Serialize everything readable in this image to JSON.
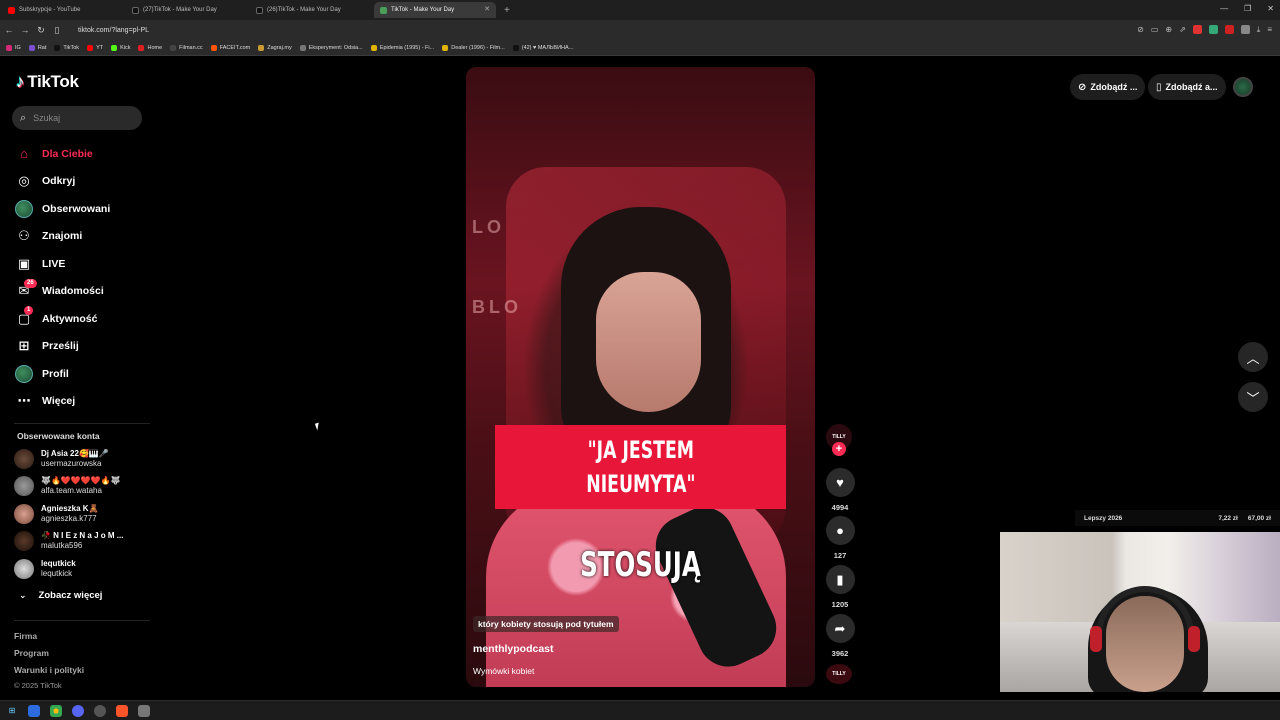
{
  "browser": {
    "tabs": [
      {
        "title": "Subskrypcje - YouTube",
        "favicon_color": "#ff0000",
        "active": false
      },
      {
        "title": "(27)TikTok - Make Your Day",
        "favicon_color": "#111111",
        "active": false
      },
      {
        "title": "(26)TikTok - Make Your Day",
        "favicon_color": "#111111",
        "active": false
      },
      {
        "title": "TikTok - Make Your Day",
        "favicon_color": "#4a9e58",
        "active": true
      }
    ],
    "new_tab": "+",
    "url": "tiktok.com/?lang=pl-PL",
    "bookmarks": [
      {
        "label": "IG",
        "color": "#d62976"
      },
      {
        "label": "Rat",
        "color": "#7a4fd1"
      },
      {
        "label": "TikTok",
        "color": "#111111"
      },
      {
        "label": "YT",
        "color": "#ff0000"
      },
      {
        "label": "Kick",
        "color": "#53fc18"
      },
      {
        "label": "Home",
        "color": "#e02020"
      },
      {
        "label": "Filman.cc",
        "color": "#444444"
      },
      {
        "label": "FACEIT.com",
        "color": "#ff5500"
      },
      {
        "label": "Zagraj.my",
        "color": "#cc9933"
      },
      {
        "label": "Eksperyment: Odsia...",
        "color": "#777777"
      },
      {
        "label": "Epidemia (1995) - Fi...",
        "color": "#e0b400"
      },
      {
        "label": "Dealer (1996) - Film...",
        "color": "#e0b400"
      },
      {
        "label": "(42) ♥ МАЛЬВИНА...",
        "color": "#111111"
      }
    ]
  },
  "tiktok": {
    "logo_text": "TikTok",
    "search_placeholder": "Szukaj",
    "nav": [
      {
        "label": "Dla Ciebie",
        "icon": "home-icon",
        "active": true
      },
      {
        "label": "Odkryj",
        "icon": "compass-icon"
      },
      {
        "label": "Obserwowani",
        "icon": "avatar-icon"
      },
      {
        "label": "Znajomi",
        "icon": "friends-icon"
      },
      {
        "label": "LIVE",
        "icon": "live-icon"
      },
      {
        "label": "Wiadomości",
        "icon": "messages-icon",
        "badge": "26"
      },
      {
        "label": "Aktywność",
        "icon": "activity-icon",
        "badge": "1"
      },
      {
        "label": "Prześlij",
        "icon": "upload-icon"
      },
      {
        "label": "Profil",
        "icon": "profile-icon"
      },
      {
        "label": "Więcej",
        "icon": "more-icon"
      }
    ],
    "followed_title": "Obserwowane konta",
    "followed": [
      {
        "name": "Dj Asia 22🥰🎹🎤",
        "handle": "usermazurowska"
      },
      {
        "name": "🐺🔥❤️❤️❤️❤️🔥🐺",
        "handle": "alfa.team.wataha"
      },
      {
        "name": "Agnieszka K🧸",
        "handle": "agnieszka.k777"
      },
      {
        "name": "🥀 N I E z N a J o M ...",
        "handle": "malutka596"
      },
      {
        "name": "lequtkick",
        "handle": "lequtkick"
      }
    ],
    "see_more": "Zobacz więcej",
    "footer": [
      "Firma",
      "Program",
      "Warunki i polityki"
    ],
    "copyright": "© 2025 TikTok",
    "top_buttons": [
      "Zdobądź ...",
      "Zdobądź a..."
    ]
  },
  "video": {
    "wall_text_1": "LO",
    "wall_text_2": "BLO",
    "caption_line1": "\"JA JESTEM",
    "caption_line2": "NIEUMYTA\"",
    "overlay_word": "STOSUJĄ",
    "subtitle": "który kobiety stosują pod tytułem",
    "author": "menthlypodcast",
    "description": "Wymówki kobiet",
    "creator_badge": "TILLY",
    "counts": {
      "likes": "4994",
      "comments": "127",
      "saves": "1205",
      "shares": "3962"
    }
  },
  "ticker": {
    "left": "Lepszy 2026",
    "mid": "7,22 zł",
    "right": "67,00 zł"
  }
}
